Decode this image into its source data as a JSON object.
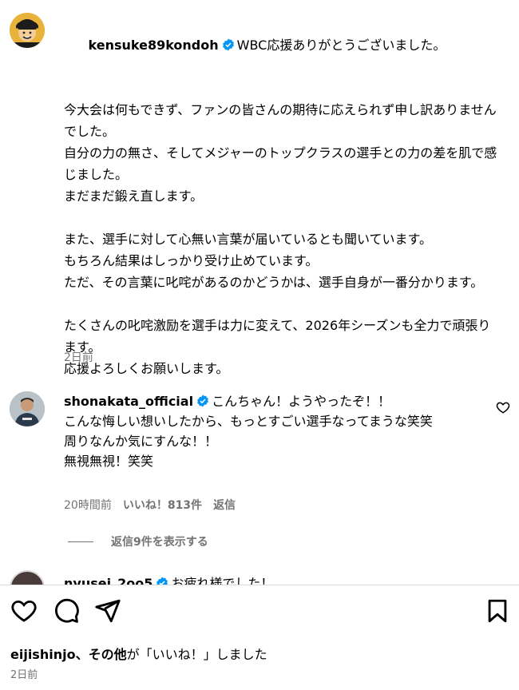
{
  "post": {
    "username": "kensuke89kondoh",
    "first_line": "WBC応援ありがとうございました。",
    "paragraphs": [
      "今大会は何もできず、ファンの皆さんの期待に応えられず申し訳ありませんでした。\n自分の力の無さ、そしてメジャーのトップクラスの選手との力の差を肌で感じました。\nまだまだ鍛え直します。",
      "また、選手に対して心無い言葉が届いているとも聞いています。\nもちろん結果はしっかり受け止めています。\nただ、その言葉に叱咤があるのかどうかは、選手自身が一番分かります。",
      "たくさんの叱咤激励を選手は力に変えて、2026年シーズンも全力で頑張ります。\n応援よろしくお願いします。"
    ],
    "time": "2日前"
  },
  "comment": {
    "username": "shonakata_official",
    "text": "こんちゃん！ようやったぞ！！\nこんな悔しい想いしたから、もっとすごい選手なってまうな笑笑\n周りなんか気にすんな！！\n無視無視！笑笑",
    "time": "20時間前",
    "likes": "いいね！813件",
    "reply": "返信",
    "view_replies": "返信9件を表示する"
  },
  "partial_comment": {
    "username": "nyusei_2oo5",
    "text": "お疲れ様でした！"
  },
  "footer": {
    "liked_user": "eijishinjo",
    "liked_sep": "、",
    "others": "その他",
    "liked_suffix": "が「いいね！」しました",
    "time": "2日前"
  },
  "icons": {
    "verified": "verified-badge-icon",
    "like": "heart-icon",
    "comment": "comment-icon",
    "share": "send-icon",
    "save": "bookmark-icon"
  },
  "colors": {
    "verified": "#0095f6",
    "secondary_text": "#737373",
    "divider": "#dbdbdb"
  }
}
